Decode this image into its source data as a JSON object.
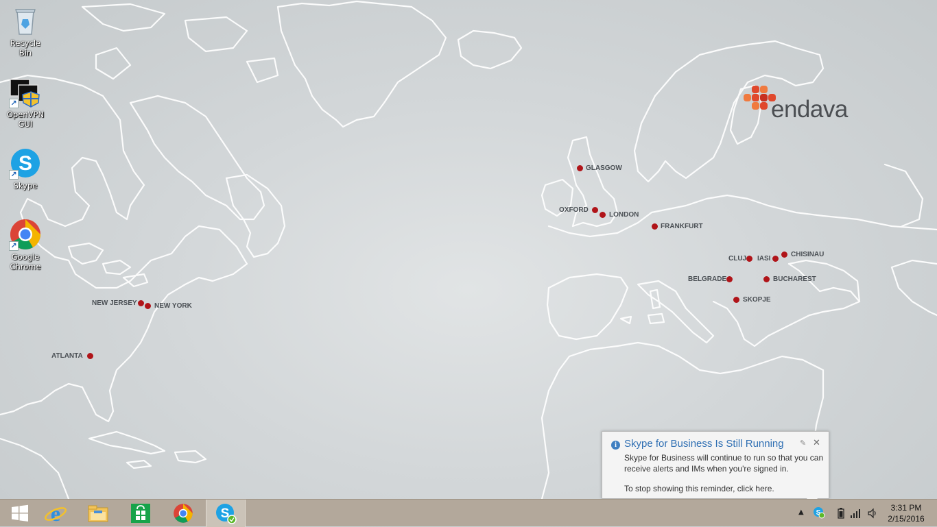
{
  "desktop_icons": [
    {
      "id": "recycle-bin",
      "label": "Recycle Bin",
      "icon": "recycle-bin-icon"
    },
    {
      "id": "openvpn",
      "label": "OpenVPN GUI",
      "icon": "openvpn-icon"
    },
    {
      "id": "skype",
      "label": "Skype",
      "icon": "skype-icon"
    },
    {
      "id": "chrome",
      "label": "Google Chrome",
      "icon": "chrome-icon"
    }
  ],
  "wallpaper": {
    "brand": "endava",
    "brand_colors": {
      "logo": "#e0482c",
      "text": "#4b4e52"
    },
    "map_line_color": "#ffffff",
    "city_dot_color": "#b01419",
    "cities": {
      "new_jersey": "NEW JERSEY",
      "new_york": "NEW YORK",
      "atlanta": "ATLANTA",
      "glasgow": "GLASGOW",
      "oxford": "OXFORD",
      "london": "LONDON",
      "frankfurt": "FRANKFURT",
      "cluj": "CLUJ",
      "iasi": "IASI",
      "chisinau": "CHISINAU",
      "belgrade": "BELGRADE",
      "bucharest": "BUCHAREST",
      "skopje": "SKOPJE"
    }
  },
  "notification": {
    "title": "Skype for Business Is Still Running",
    "body": "Skype for Business will continue to run so that you can receive alerts and IMs when you're signed in.",
    "link": "To stop showing this reminder, click here.",
    "close_glyph": "✕",
    "info_glyph": "i"
  },
  "taskbar": {
    "background": "#b3a89b",
    "pinned": [
      {
        "name": "start-button",
        "icon": "windows-logo-icon"
      },
      {
        "name": "internet-explorer-button",
        "icon": "internet-explorer-icon"
      },
      {
        "name": "file-explorer-button",
        "icon": "file-explorer-icon"
      },
      {
        "name": "store-button",
        "icon": "store-icon"
      },
      {
        "name": "chrome-taskbar-button",
        "icon": "chrome-icon"
      },
      {
        "name": "skype-business-taskbar-button",
        "icon": "skype-icon",
        "active": true
      }
    ],
    "tray": [
      "show-hidden-icons-icon",
      "skype-tray-icon",
      "battery-icon",
      "signal-icon",
      "volume-icon"
    ],
    "clock": {
      "time": "3:31 PM",
      "date": "2/15/2016"
    }
  }
}
